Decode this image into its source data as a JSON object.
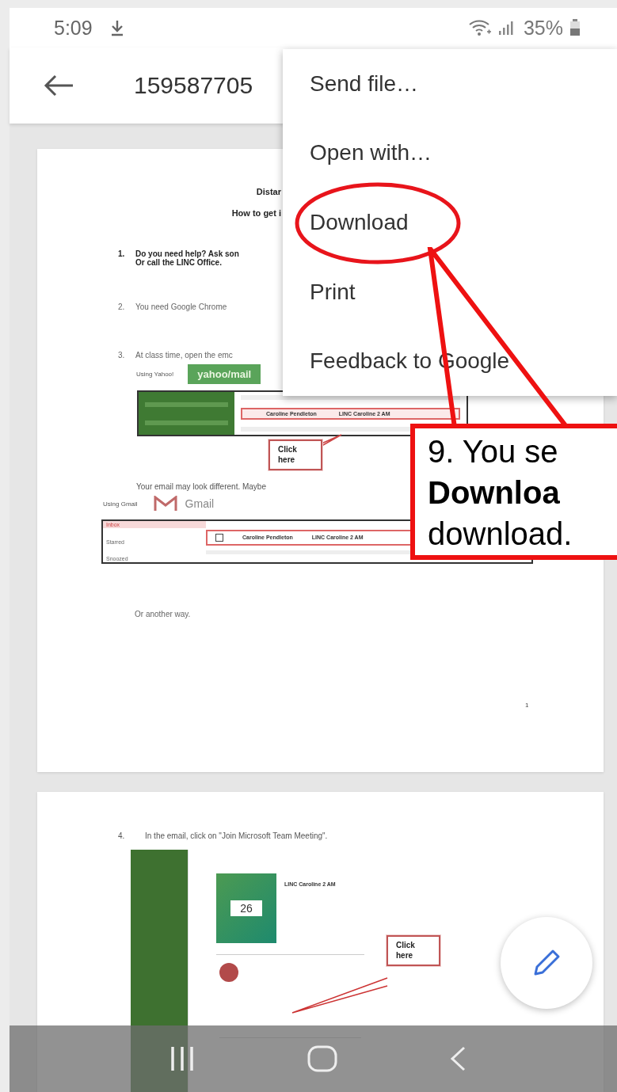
{
  "status_bar": {
    "time": "5:09",
    "battery": "35%"
  },
  "app_bar": {
    "title": "159587705"
  },
  "page_1": {
    "heading": "Distar",
    "subheading": "How to get i",
    "step_1": {
      "number": "1.",
      "lines": [
        "Do you need help?  Ask son",
        "Or call the LINC Office."
      ]
    },
    "step_2": {
      "number": "2.",
      "text": "You need Google Chrome"
    },
    "step_3": {
      "number": "3.",
      "text": "At class time, open the emc"
    },
    "yahoo": {
      "label": "Using Yahoo!",
      "logo": "yahoo/mail",
      "sender": "Caroline Pendleton",
      "subject": "LINC Caroline 2 AM",
      "callout": "Click here"
    },
    "note": "Your email may look different.  Maybe",
    "gmail": {
      "label": "Using Gmail",
      "logo": "Gmail",
      "folders": [
        "Inbox",
        "Starred",
        "Snoozed"
      ],
      "sender": "Caroline Pendleton",
      "subject": "LINC Caroline 2 AM"
    },
    "footer_note": "Or another way.",
    "page_number": "1"
  },
  "page_2": {
    "step": {
      "number": "4.",
      "text": "In the email, click on \"Join Microsoft Team Meeting\"."
    },
    "calendar_day": "26",
    "event_title": "LINC Caroline 2 AM",
    "callout": "Click here"
  },
  "menu": {
    "items": [
      {
        "label": "Send file…",
        "circled": false
      },
      {
        "label": "Open with…",
        "circled": false
      },
      {
        "label": "Download",
        "circled": true
      },
      {
        "label": "Print",
        "circled": false
      },
      {
        "label": "Feedback to Google",
        "circled": false
      }
    ]
  },
  "callout": {
    "text": "9. You se\n**Downloa**\ndownload."
  }
}
